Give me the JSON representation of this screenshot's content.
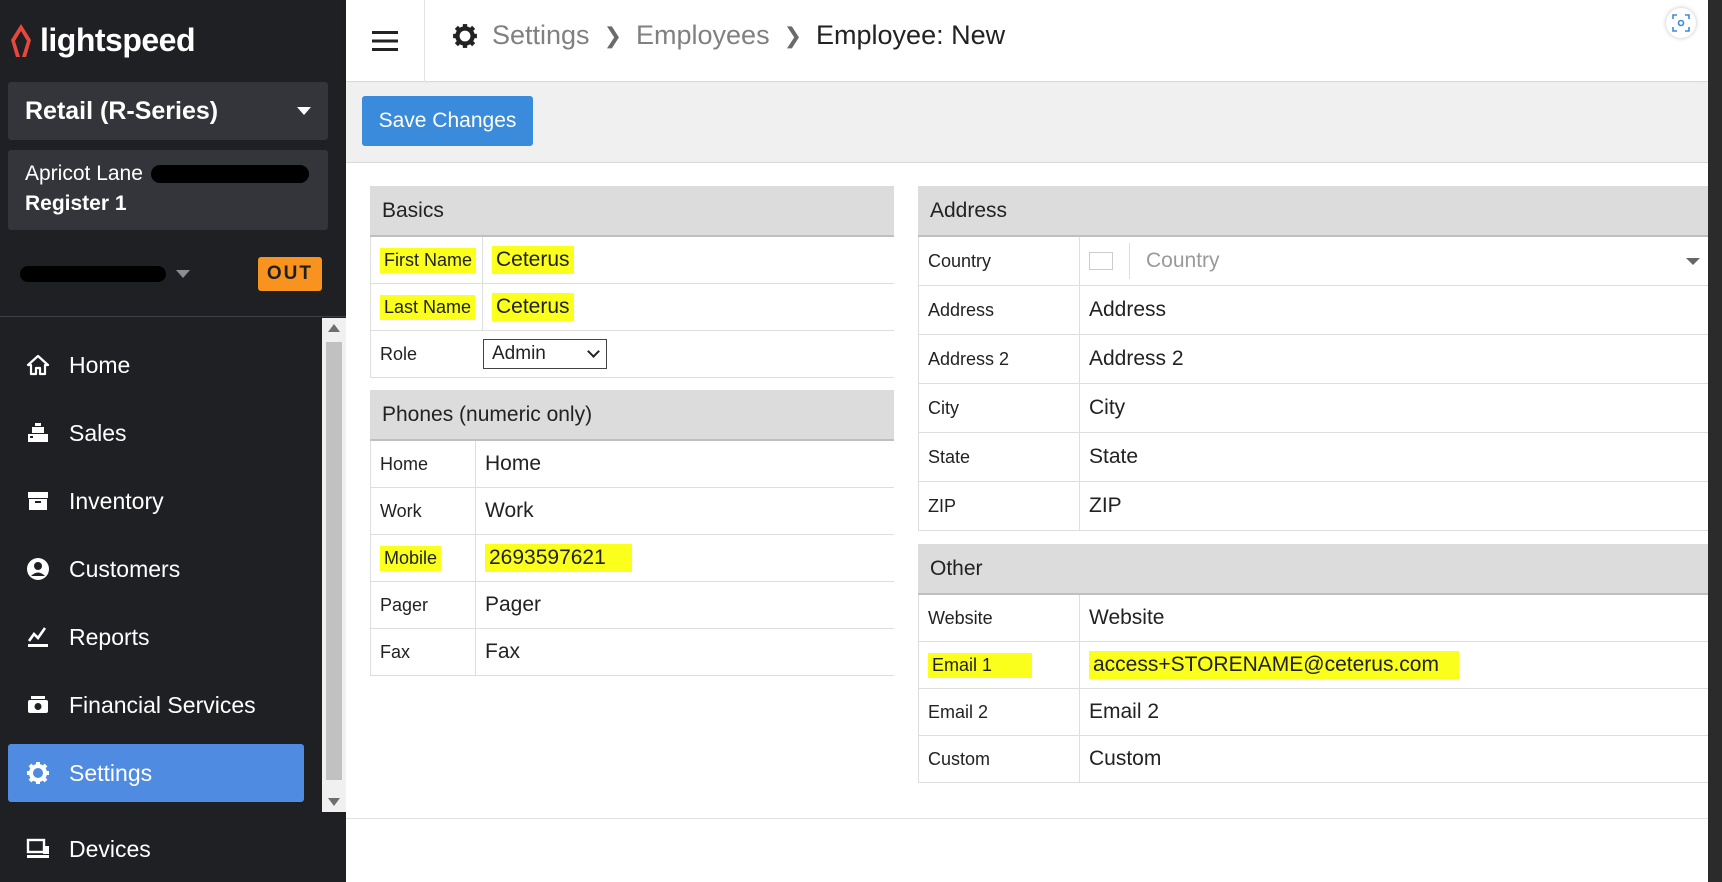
{
  "app": {
    "logo_text": "lightspeed"
  },
  "sidebar": {
    "product": "Retail (R-Series)",
    "store_name": "Apricot Lane",
    "register": "Register 1",
    "clock_status": "OUT",
    "nav": [
      {
        "label": "Home",
        "icon": "home-icon"
      },
      {
        "label": "Sales",
        "icon": "register-icon"
      },
      {
        "label": "Inventory",
        "icon": "inventory-icon"
      },
      {
        "label": "Customers",
        "icon": "customer-icon"
      },
      {
        "label": "Reports",
        "icon": "chart-icon"
      },
      {
        "label": "Financial Services",
        "icon": "cash-icon"
      },
      {
        "label": "Settings",
        "icon": "gear-icon",
        "active": true
      },
      {
        "label": "Devices",
        "icon": "devices-icon"
      }
    ]
  },
  "header": {
    "breadcrumb": [
      "Settings",
      "Employees",
      "Employee: New"
    ]
  },
  "toolbar": {
    "save_label": "Save Changes"
  },
  "basics": {
    "title": "Basics",
    "first_name_label": "First Name",
    "first_name_value": "Ceterus",
    "last_name_label": "Last Name",
    "last_name_value": "Ceterus",
    "role_label": "Role",
    "role_value": "Admin"
  },
  "phones": {
    "title": "Phones (numeric only)",
    "home_label": "Home",
    "home_placeholder": "Home",
    "work_label": "Work",
    "work_placeholder": "Work",
    "mobile_label": "Mobile",
    "mobile_value": "2693597621",
    "pager_label": "Pager",
    "pager_placeholder": "Pager",
    "fax_label": "Fax",
    "fax_placeholder": "Fax"
  },
  "address": {
    "title": "Address",
    "country_label": "Country",
    "country_placeholder": "Country",
    "address_label": "Address",
    "address_placeholder": "Address",
    "address2_label": "Address 2",
    "address2_placeholder": "Address 2",
    "city_label": "City",
    "city_placeholder": "City",
    "state_label": "State",
    "state_placeholder": "State",
    "zip_label": "ZIP",
    "zip_placeholder": "ZIP"
  },
  "other": {
    "title": "Other",
    "website_label": "Website",
    "website_placeholder": "Website",
    "email1_label": "Email 1",
    "email1_value": "access+STORENAME@ceterus.com",
    "email2_label": "Email 2",
    "email2_placeholder": "Email 2",
    "custom_label": "Custom",
    "custom_placeholder": "Custom"
  },
  "colors": {
    "sidebar_bg": "#1f2024",
    "accent": "#4f8be0",
    "save_button": "#3b8bdc",
    "out_badge": "#f7931e",
    "highlight": "#fbff1c"
  }
}
